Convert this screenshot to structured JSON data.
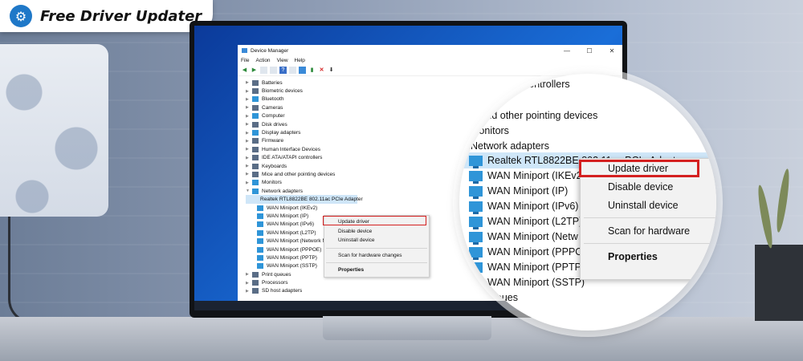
{
  "brand": {
    "name": "Free Driver Updater"
  },
  "window": {
    "title": "Device Manager",
    "controls": {
      "minimize": "—",
      "maximize": "☐",
      "close": "✕"
    },
    "menu": [
      "File",
      "Action",
      "View",
      "Help"
    ],
    "toolbar_icons": [
      "back-arrow-icon",
      "forward-arrow-icon",
      "properties-icon",
      "show-hidden-icon",
      "help-icon",
      "view-icon",
      "monitor-icon",
      "update-driver-icon",
      "uninstall-x-icon",
      "download-icon"
    ]
  },
  "tree": {
    "categories": [
      "Batteries",
      "Biometric devices",
      "Bluetooth",
      "Cameras",
      "Computer",
      "Disk drives",
      "Display adapters",
      "Firmware",
      "Human Interface Devices",
      "IDE ATA/ATAPI controllers",
      "Keyboards",
      "Mice and other pointing devices",
      "Monitors",
      "Network adapters"
    ],
    "network_adapters": [
      "Realtek RTL8822BE 802.11ac PCIe Adapter",
      "WAN Miniport (IKEv2)",
      "WAN Miniport (IP)",
      "WAN Miniport (IPv6)",
      "WAN Miniport (L2TP)",
      "WAN Miniport (Network Monitor)",
      "WAN Miniport (PPPOE)",
      "WAN Miniport (PPTP)",
      "WAN Miniport (SSTP)"
    ],
    "after": [
      "Print queues",
      "Processors",
      "SD host adapters"
    ]
  },
  "context_menu": {
    "update": "Update driver",
    "disable": "Disable device",
    "uninstall": "Uninstall device",
    "scan": "Scan for hardware changes",
    "properties": "Properties"
  },
  "magnifier": {
    "lines": [
      "controllers",
      "ards",
      "e and other pointing devices",
      "Monitors",
      "Network adapters"
    ],
    "adapters": [
      "Realtek RTL8822BE 802.11ac PCIe Adapt",
      "WAN Miniport (IKEv2",
      "WAN Miniport (IP)",
      "WAN Miniport (IPv6)",
      "WAN Miniport (L2TP)",
      "WAN Miniport (Netw",
      "WAN Miniport (PPPO",
      "WAN Miniport (PPTP)",
      "WAN Miniport (SSTP)"
    ],
    "tail": "queues",
    "menu": {
      "update": "Update driver",
      "disable": "Disable device",
      "uninstall": "Uninstall device",
      "scan": "Scan for hardware",
      "properties": "Properties"
    }
  }
}
